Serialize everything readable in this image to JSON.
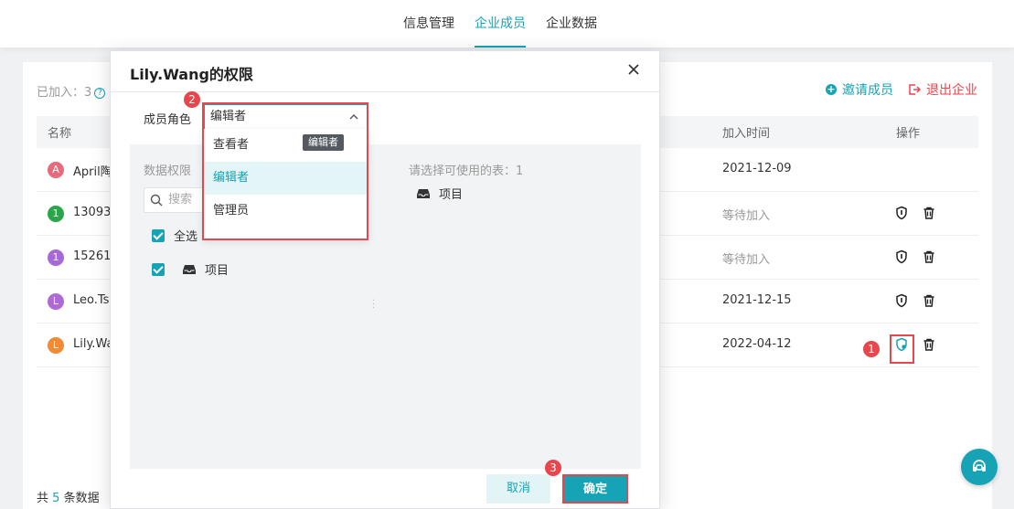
{
  "nav": {
    "tabs": [
      {
        "label": "信息管理",
        "active": false
      },
      {
        "label": "企业成员",
        "active": true
      },
      {
        "label": "企业数据",
        "active": false
      }
    ]
  },
  "members": {
    "joined_label": "已加入：3",
    "invite_label": "邀请成员",
    "exit_label": "退出企业",
    "columns": {
      "name": "名称",
      "joined_time": "加入时间",
      "ops": "操作"
    },
    "rows": [
      {
        "avatar": "A",
        "avatar_color": "#e76b7c",
        "name": "April陶",
        "time": "2021-12-09",
        "pending": false,
        "ops": false
      },
      {
        "avatar": "1",
        "avatar_color": "#2aa54b",
        "name": "13093",
        "time": "等待加入",
        "pending": true,
        "ops": true
      },
      {
        "avatar": "1",
        "avatar_color": "#a66ad6",
        "name": "15261",
        "time": "等待加入",
        "pending": true,
        "ops": true
      },
      {
        "avatar": "L",
        "avatar_color": "#b06ad6",
        "name": "Leo.Ts",
        "time": "2021-12-15",
        "pending": false,
        "ops": true
      },
      {
        "avatar": "L",
        "avatar_color": "#f08a35",
        "name": "Lily.Wa",
        "time": "2022-04-12",
        "pending": false,
        "ops": true
      }
    ],
    "footer": {
      "prefix": "共",
      "count": "5",
      "suffix": "条数据"
    }
  },
  "dialog": {
    "title": "Lily.Wang的权限",
    "role_label": "成员角色",
    "role_value": "编辑者",
    "tooltip": "编辑者",
    "options": [
      "查看者",
      "编辑者",
      "管理员"
    ],
    "selected_option": "编辑者",
    "data_perm_label": "数据权限",
    "search_placeholder": "搜索",
    "select_all_label": "全选",
    "left_item": "项目",
    "right_title": "请选择可使用的表：1",
    "right_item": "项目",
    "cancel_label": "取消",
    "ok_label": "确定"
  },
  "steps": [
    "1",
    "2",
    "3"
  ],
  "colors": {
    "accent": "#16a3b5",
    "danger": "#e8464d"
  }
}
